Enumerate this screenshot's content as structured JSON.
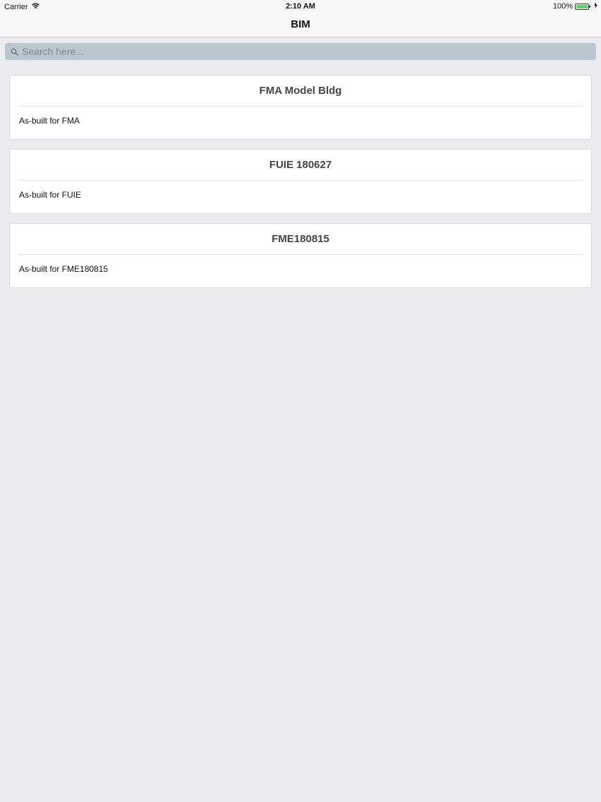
{
  "status_bar": {
    "carrier": "Carrier",
    "time": "2:10 AM",
    "battery": "100%",
    "battery_level": 1.0
  },
  "nav": {
    "title": "BIM"
  },
  "search": {
    "placeholder": "Search here...",
    "value": ""
  },
  "items": [
    {
      "title": "FMA Model Bldg",
      "description": "As-built for FMA"
    },
    {
      "title": "FUIE 180627",
      "description": "As-built for FUIE"
    },
    {
      "title": "FME180815",
      "description": "As-built for FME180815"
    }
  ],
  "colors": {
    "background": "#ebebf0",
    "search_field": "#bcc6cf",
    "battery": "#4cd964"
  }
}
